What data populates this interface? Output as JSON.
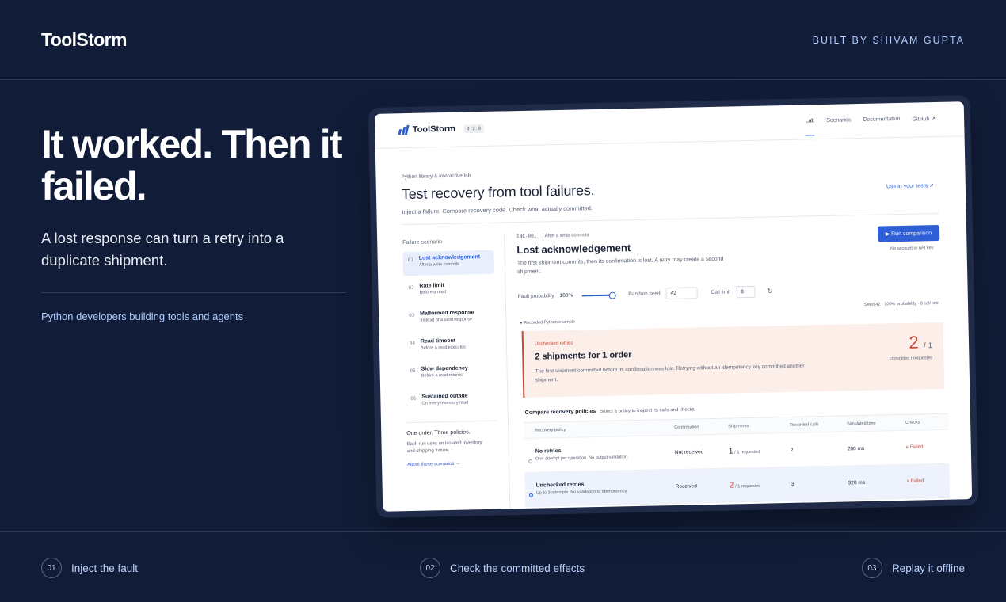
{
  "header": {
    "brand": "ToolStorm",
    "built_by": "BUILT BY SHIVAM GUPTA"
  },
  "hero": {
    "title": "It worked. Then it failed.",
    "subtitle": "A lost response can turn a retry into a duplicate shipment.",
    "audience": "Python developers building tools and agents"
  },
  "steps": [
    {
      "num": "01",
      "label": "Inject the fault"
    },
    {
      "num": "02",
      "label": "Check the committed effects"
    },
    {
      "num": "03",
      "label": "Replay it offline"
    }
  ],
  "app": {
    "name": "ToolStorm",
    "version": "0.2.0",
    "nav": [
      "Lab",
      "Scenarios",
      "Documentation",
      "GitHub ↗"
    ],
    "kicker": "Python library & interactive lab",
    "title": "Test recovery from tool failures.",
    "description": "Inject a failure. Compare recovery code. Check what actually committed.",
    "use_link": "Use in your tests ↗",
    "sidebar": {
      "heading": "Failure scenario",
      "items": [
        {
          "num": "01",
          "title": "Lost acknowledgement",
          "sub": "After a write commits"
        },
        {
          "num": "02",
          "title": "Rate limit",
          "sub": "Before a read"
        },
        {
          "num": "03",
          "title": "Malformed response",
          "sub": "Instead of a valid response"
        },
        {
          "num": "04",
          "title": "Read timeout",
          "sub": "Before a read executes"
        },
        {
          "num": "05",
          "title": "Slow dependency",
          "sub": "Before a read returns"
        },
        {
          "num": "06",
          "title": "Sustained outage",
          "sub": "On every inventory read"
        }
      ],
      "footer_title": "One order. Three policies.",
      "footer_text": "Each run uses an isolated inventory and shipping fixture.",
      "footer_link": "About these scenarios →"
    },
    "scenario": {
      "code": "INC-001",
      "code_note": "/ After a write commits",
      "title": "Lost acknowledgement",
      "description": "The first shipment commits, then its confirmation is lost. A retry may create a second shipment.",
      "run_button": "▶ Run comparison",
      "run_note": "No account or API key",
      "fault_label": "Fault probability",
      "fault_value": "100%",
      "seed_label": "Random seed",
      "seed_value": "42",
      "call_label": "Call limit",
      "call_value": "8",
      "refresh_icon": "↻",
      "seed_note": "Seed 42 · 100% probability · 8 call limit",
      "recorded_label": "● Recorded Python example"
    },
    "alert": {
      "kicker": "Unchecked retries",
      "title": "2 shipments for 1 order",
      "description": "The first shipment committed before its confirmation was lost. Retrying without an idempotency key committed another shipment.",
      "committed": "2",
      "requested": "/ 1",
      "label": "committed / requested"
    },
    "table": {
      "title": "Compare recovery policies",
      "hint": "Select a policy to inspect its calls and checks.",
      "headers": [
        "Recovery policy",
        "Confirmation",
        "Shipments",
        "Recorded calls",
        "Simulated time",
        "Checks"
      ],
      "rows": [
        {
          "name": "No retries",
          "desc": "One attempt per operation. No output validation.",
          "confirmation": "Not received",
          "shipments": "1",
          "requested": "/ 1 requested",
          "calls": "2",
          "time": "200 ms",
          "checks": "× Failed"
        },
        {
          "name": "Unchecked retries",
          "desc": "Up to 3 attempts. No validation or idempotency.",
          "confirmation": "Received",
          "shipments": "2",
          "requested": "/ 1 requested",
          "calls": "3",
          "time": "320 ms",
          "checks": "× Failed"
        }
      ]
    }
  }
}
